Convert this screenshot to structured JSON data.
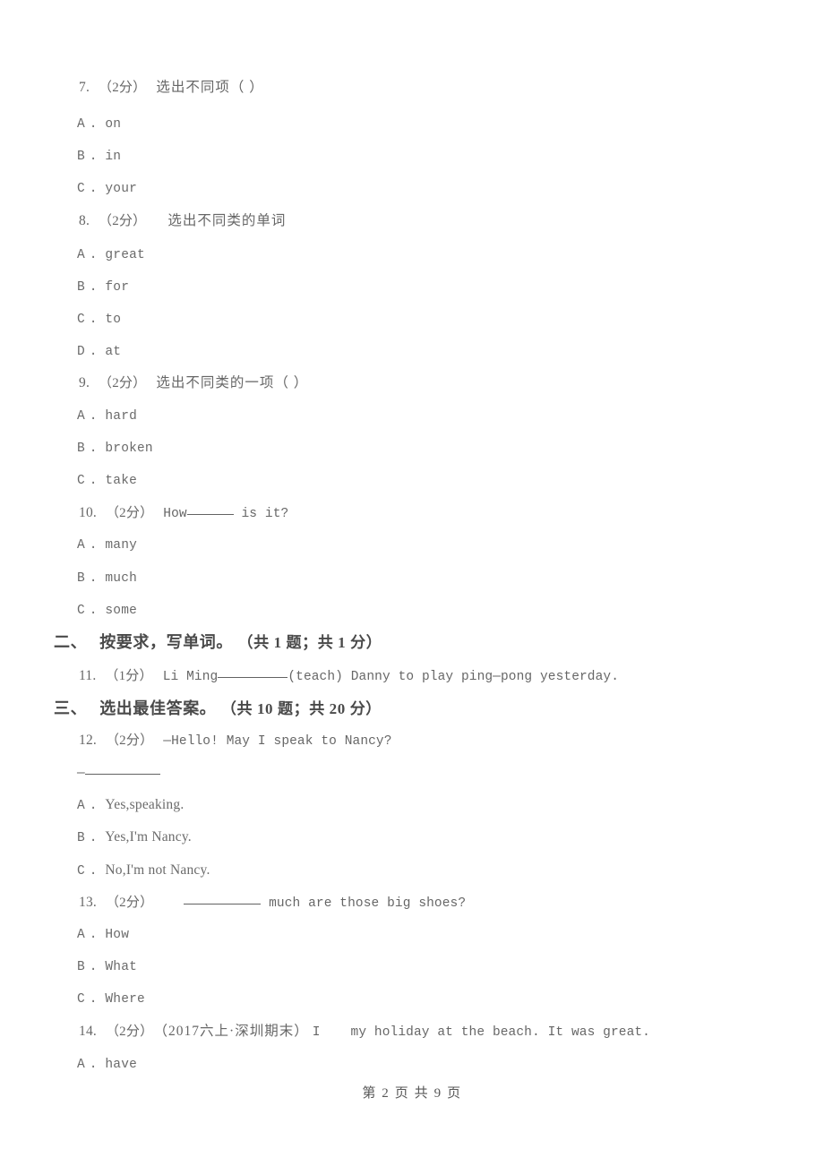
{
  "document": {
    "page_background": "#ffffff",
    "text_color": "#555555",
    "footer": "第 2 页 共 9 页"
  },
  "questions": [
    {
      "id": "q7",
      "number": "7.",
      "score": "（2分）",
      "stem": "选出不同项（      ）",
      "stem_lang": "cn",
      "options": [
        {
          "letter": "A",
          "dot": ".",
          "text": "on"
        },
        {
          "letter": "B",
          "dot": ".",
          "text": "in"
        },
        {
          "letter": "C",
          "dot": ".",
          "text": "your"
        }
      ]
    },
    {
      "id": "q8",
      "number": "8.",
      "score": "（2分）",
      "stem": "选出不同类的单词",
      "stem_lang": "cn",
      "options": [
        {
          "letter": "A",
          "dot": ".",
          "text": "great"
        },
        {
          "letter": "B",
          "dot": ".",
          "text": "for"
        },
        {
          "letter": "C",
          "dot": ".",
          "text": "to"
        },
        {
          "letter": "D",
          "dot": ".",
          "text": "at"
        }
      ]
    },
    {
      "id": "q9",
      "number": "9.",
      "score": "（2分）",
      "stem": "选出不同类的一项（      ）",
      "stem_lang": "cn",
      "options": [
        {
          "letter": "A",
          "dot": ".",
          "text": "hard"
        },
        {
          "letter": "B",
          "dot": ".",
          "text": "broken"
        },
        {
          "letter": "C",
          "dot": ".",
          "text": "take"
        }
      ]
    },
    {
      "id": "q10",
      "number": "10.",
      "score": "（2分）",
      "stem_before": "How",
      "stem_after": " is it?",
      "options": [
        {
          "letter": "A",
          "dot": ".",
          "text": "many"
        },
        {
          "letter": "B",
          "dot": ".",
          "text": "much"
        },
        {
          "letter": "C",
          "dot": ".",
          "text": "some"
        }
      ]
    },
    {
      "id": "q11",
      "number": "11.",
      "score": "（1分）",
      "stem_before": "Li Ming",
      "stem_after": "(teach) Danny to play ping—pong yesterday.",
      "options": []
    },
    {
      "id": "q12",
      "number": "12.",
      "score": "（2分）",
      "stem": "—Hello! May I speak to Nancy?",
      "stem_line2_dash": "—",
      "options": [
        {
          "letter": "A",
          "dot": ".",
          "text": "Yes,speaking."
        },
        {
          "letter": "B",
          "dot": ".",
          "text": "Yes,I'm Nancy."
        },
        {
          "letter": "C",
          "dot": ".",
          "text": "No,I'm not Nancy."
        }
      ]
    },
    {
      "id": "q13",
      "number": "13.",
      "score": "（2分）",
      "stem_before": "",
      "stem_after": " much are those big shoes?",
      "options": [
        {
          "letter": "A",
          "dot": ".",
          "text": "How"
        },
        {
          "letter": "B",
          "dot": ".",
          "text": "What"
        },
        {
          "letter": "C",
          "dot": ".",
          "text": "Where"
        }
      ]
    },
    {
      "id": "q14",
      "number": "14.",
      "score": "（2分）",
      "source": "（2017六上·深圳期末）",
      "stem_before": "I",
      "stem_after": "my holiday at the beach. It was great.",
      "options": [
        {
          "letter": "A",
          "dot": ".",
          "text": "have"
        }
      ]
    }
  ],
  "sections": [
    {
      "id": "section-2",
      "index": "二、",
      "title": "按要求，写单词。",
      "count": "（共 1 题；共 1 分）"
    },
    {
      "id": "section-3",
      "index": "三、",
      "title": "选出最佳答案。",
      "count": "（共 10 题；共 20 分）"
    }
  ]
}
